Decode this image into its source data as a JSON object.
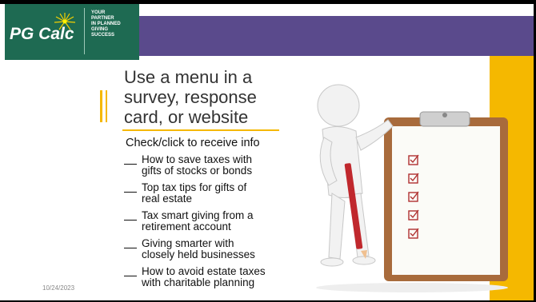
{
  "header": {
    "logo_text": "PG Calc",
    "tagline": [
      "YOUR",
      "PARTNER",
      "IN PLANNED",
      "GIVING",
      "SUCCESS"
    ]
  },
  "slide": {
    "title_lines": [
      "Use a menu in a",
      "survey, response",
      "card, or website"
    ],
    "subtitle": "Check/click to receive info",
    "items": [
      {
        "line1": "How to save taxes with",
        "line2": "gifts of stocks or bonds"
      },
      {
        "line1": "Top tax tips for gifts of",
        "line2": "real estate"
      },
      {
        "line1": "Tax smart giving from a",
        "line2": "retirement account"
      },
      {
        "line1": "Giving smarter with",
        "line2": "closely held businesses"
      },
      {
        "line1": "How to avoid estate taxes",
        "line2": "with charitable planning"
      }
    ],
    "date": "10/24/2023"
  },
  "illustration": {
    "name": "figure-with-clipboard-checklist",
    "checked_boxes": 5
  },
  "colors": {
    "header_purple": "#5a4a8c",
    "logo_green": "#1e6a52",
    "accent_yellow": "#f5b800",
    "check_red": "#b03030"
  }
}
